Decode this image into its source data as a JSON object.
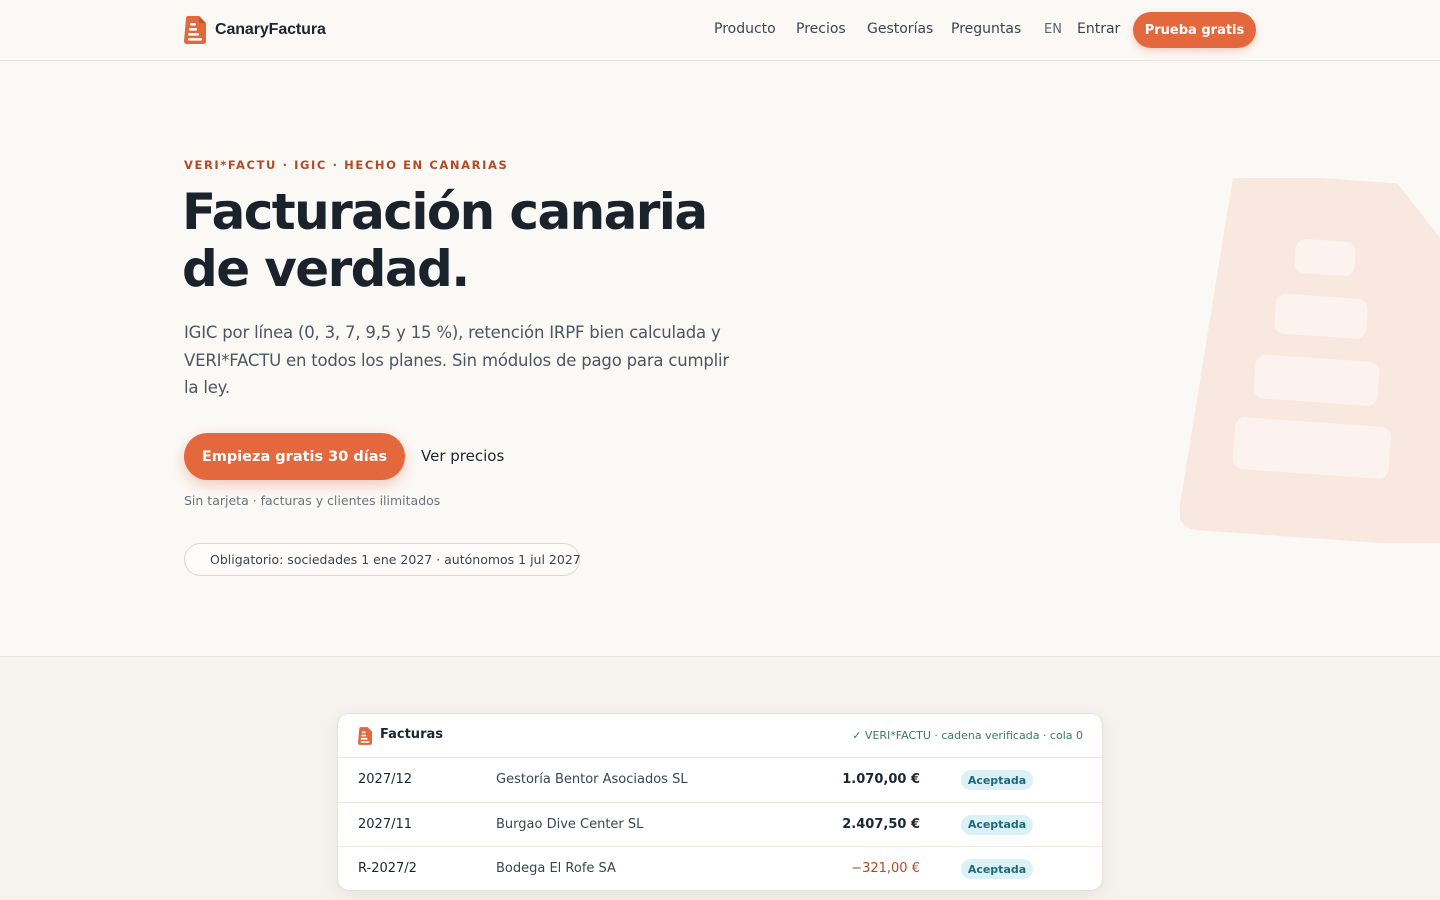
{
  "header": {
    "brand_name": "CanaryFactura",
    "nav": [
      "Producto",
      "Precios",
      "Gestorías",
      "Preguntas"
    ],
    "lang": "EN",
    "signin": "Entrar",
    "cta": "Prueba gratis"
  },
  "hero": {
    "eyebrow": "VERI*FACTU · IGIC · HECHO EN CANARIAS",
    "title_line1": "Facturación canaria",
    "title_line2": "de verdad.",
    "subtitle": "IGIC por línea (0, 3, 7, 9,5 y 15 %), retención IRPF bien calculada y VERI*FACTU en todos los planes. Sin módulos de pago para cumplir la ley.",
    "cta_primary": "Empieza gratis 30 días",
    "cta_secondary": "Ver precios",
    "note": "Sin tarjeta · facturas y clientes ilimitados",
    "pill": "Obligatorio: sociedades 1 ene 2027 · autónomos 1 jul 2027"
  },
  "invoices": {
    "title": "Facturas",
    "status": "✓ VERI*FACTU · cadena verificada · cola 0",
    "rows": [
      {
        "number": "2027/12",
        "client": "Gestoría Bentor Asociados SL",
        "amount": "1.070,00 €",
        "status": "Aceptada"
      },
      {
        "number": "2027/11",
        "client": "Burgao Dive Center SL",
        "amount": "2.407,50 €",
        "status": "Aceptada"
      },
      {
        "number": "R-2027/2",
        "client": "Bodega El Rofe SA",
        "amount": "−321,00 €",
        "status": "Aceptada"
      }
    ]
  },
  "colors": {
    "accent": "#e3683e",
    "accent_dark": "#b44a25",
    "background": "#fbf9f6",
    "badge_bg": "#dcf1f6",
    "verified_green": "#3f7a5a"
  },
  "icons": {
    "brand": "invoice-logo-icon",
    "card": "invoice-logo-icon",
    "deco": "invoice-logo-watermark"
  }
}
